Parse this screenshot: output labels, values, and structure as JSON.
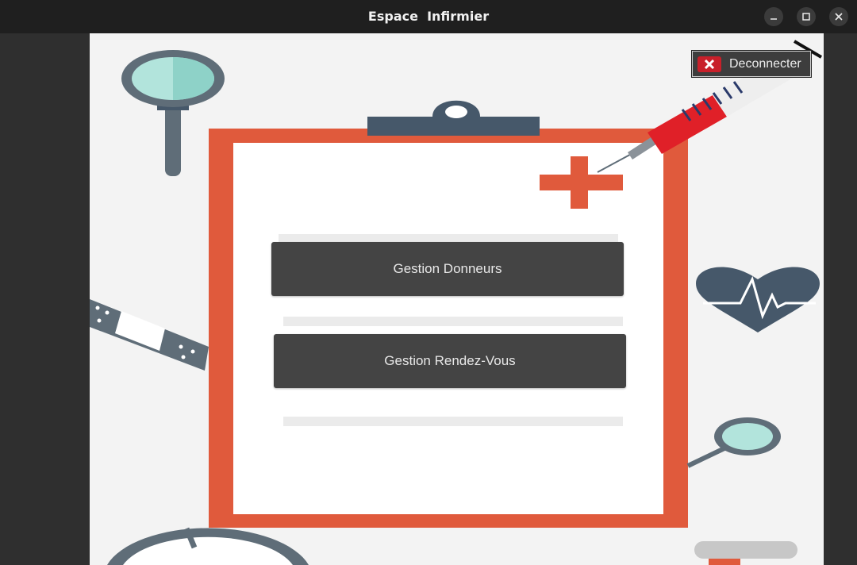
{
  "window": {
    "title": "Espace  Infirmier",
    "controls": [
      {
        "name": "minimize",
        "icon": "minimize-icon"
      },
      {
        "name": "maximize",
        "icon": "maximize-icon"
      },
      {
        "name": "close",
        "icon": "close-icon"
      }
    ]
  },
  "header": {
    "logout_label": "Deconnecter",
    "logout_icon": "x-icon"
  },
  "main": {
    "buttons": [
      {
        "label": "Gestion Donneurs"
      },
      {
        "label": "Gestion Rendez-Vous"
      }
    ]
  },
  "background": {
    "illustration": "medical-clipboard-illustration",
    "colors": {
      "clipboard": "#e05a3c",
      "paper": "#ffffff",
      "slate": "#46586a",
      "glass": "#b2e4dc",
      "syringe_red": "#e02028"
    }
  }
}
